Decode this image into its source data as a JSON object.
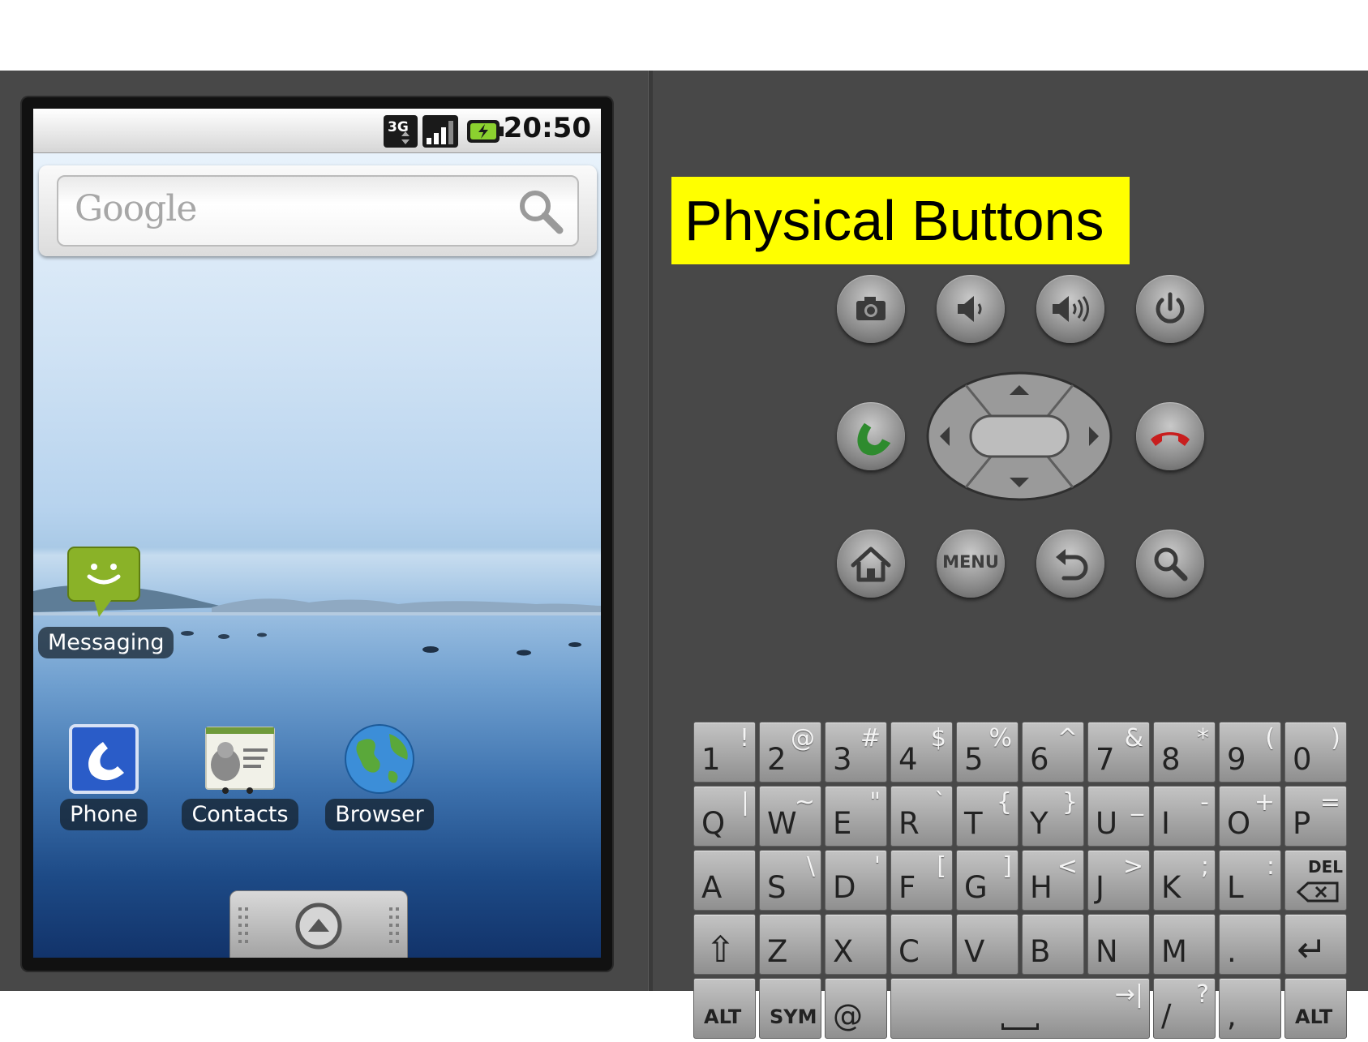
{
  "status_bar": {
    "network_label": "3G",
    "time": "20:50"
  },
  "search_widget": {
    "logo_text": "Google"
  },
  "home_apps": {
    "messaging": "Messaging",
    "phone": "Phone",
    "contacts": "Contacts",
    "browser": "Browser"
  },
  "panel": {
    "title": "Physical Buttons",
    "menu_label": "MENU"
  },
  "keyboard": {
    "rows": [
      [
        {
          "main": "1",
          "alt": "!"
        },
        {
          "main": "2",
          "alt": "@"
        },
        {
          "main": "3",
          "alt": "#"
        },
        {
          "main": "4",
          "alt": "$"
        },
        {
          "main": "5",
          "alt": "%"
        },
        {
          "main": "6",
          "alt": "^"
        },
        {
          "main": "7",
          "alt": "&"
        },
        {
          "main": "8",
          "alt": "*"
        },
        {
          "main": "9",
          "alt": "("
        },
        {
          "main": "0",
          "alt": ")"
        }
      ],
      [
        {
          "main": "Q",
          "alt": "|"
        },
        {
          "main": "W",
          "alt": "~"
        },
        {
          "main": "E",
          "alt": "\""
        },
        {
          "main": "R",
          "alt": "`"
        },
        {
          "main": "T",
          "alt": "{"
        },
        {
          "main": "Y",
          "alt": "}"
        },
        {
          "main": "U",
          "alt": "_"
        },
        {
          "main": "I",
          "alt": "-"
        },
        {
          "main": "O",
          "alt": "+"
        },
        {
          "main": "P",
          "alt": "="
        }
      ],
      [
        {
          "main": "A",
          "alt": ""
        },
        {
          "main": "S",
          "alt": "\\"
        },
        {
          "main": "D",
          "alt": "'"
        },
        {
          "main": "F",
          "alt": "["
        },
        {
          "main": "G",
          "alt": "]"
        },
        {
          "main": "H",
          "alt": "<"
        },
        {
          "main": "J",
          "alt": ">"
        },
        {
          "main": "K",
          "alt": ";"
        },
        {
          "main": "L",
          "alt": ":"
        },
        {
          "main": "DEL",
          "alt": "",
          "special": "del"
        }
      ],
      [
        {
          "main": "⇧",
          "alt": "",
          "special": "shift"
        },
        {
          "main": "Z",
          "alt": ""
        },
        {
          "main": "X",
          "alt": ""
        },
        {
          "main": "C",
          "alt": ""
        },
        {
          "main": "V",
          "alt": ""
        },
        {
          "main": "B",
          "alt": ""
        },
        {
          "main": "N",
          "alt": ""
        },
        {
          "main": "M",
          "alt": ""
        },
        {
          "main": ".",
          "alt": ""
        },
        {
          "main": "↵",
          "alt": "",
          "special": "enter"
        }
      ],
      [
        {
          "main": "ALT",
          "alt": "",
          "special": "small"
        },
        {
          "main": "SYM",
          "alt": "",
          "special": "small"
        },
        {
          "main": "@",
          "alt": ""
        },
        {
          "main": "",
          "alt": "→|",
          "special": "space"
        },
        {
          "main": "/",
          "alt": "?"
        },
        {
          "main": ",",
          "alt": ""
        },
        {
          "main": "ALT",
          "alt": "",
          "special": "small"
        }
      ]
    ]
  },
  "colors": {
    "title_bg": "#ffff00",
    "call_green": "#2e8b2e",
    "end_call_red": "#c81e1e",
    "emulator_bg": "#484848"
  },
  "icons": [
    "camera-icon",
    "volume-down-icon",
    "volume-up-icon",
    "power-icon",
    "call-icon",
    "end-call-icon",
    "home-icon",
    "back-icon",
    "search-icon"
  ]
}
